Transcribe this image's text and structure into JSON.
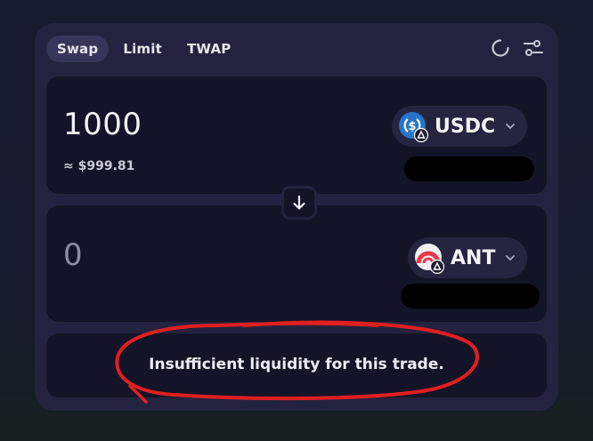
{
  "tabs": [
    {
      "label": "Swap",
      "active": true
    },
    {
      "label": "Limit",
      "active": false
    },
    {
      "label": "TWAP",
      "active": false
    }
  ],
  "header_icons": [
    "refresh-icon",
    "settings-sliders-icon"
  ],
  "from": {
    "amount": "1000",
    "usd_value": "≈ $999.81",
    "token": {
      "symbol": "USDC",
      "logo": "usdc-logo",
      "badge": "chain-badge",
      "color": "#2775ca"
    },
    "balance_redacted": true
  },
  "to": {
    "amount": "0",
    "token": {
      "symbol": "ANT",
      "logo": "ant-logo",
      "badge": "chain-badge",
      "color": "#e8394a"
    },
    "balance_redacted": true
  },
  "switch_icon": "arrow-down-icon",
  "message": "Insufficient liquidity for this trade.",
  "annotation": {
    "type": "red-circle",
    "color": "#e01f1f"
  }
}
